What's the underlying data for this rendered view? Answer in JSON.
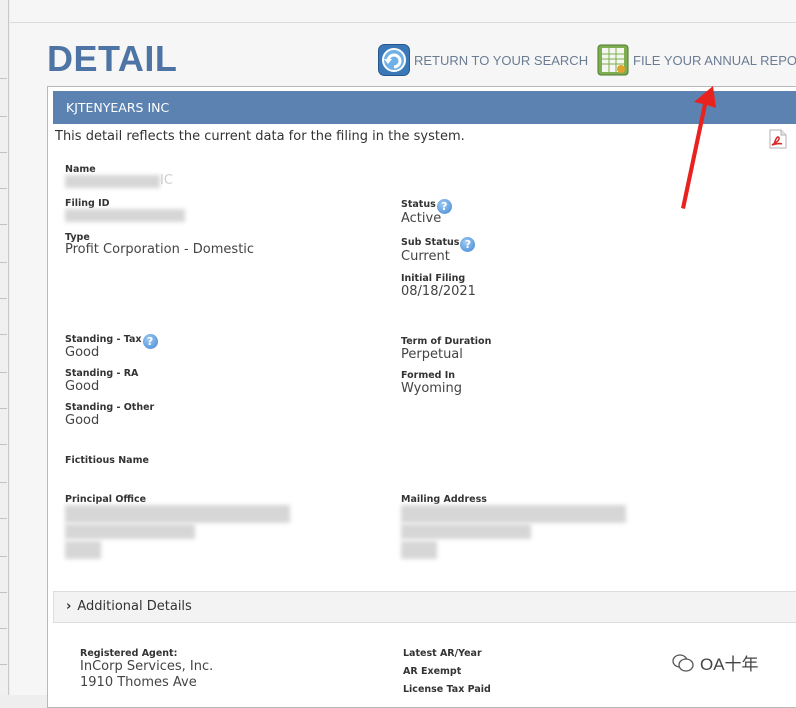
{
  "page": {
    "title": "DETAIL"
  },
  "nav": {
    "return_label": "RETURN TO YOUR SEARCH",
    "file_label": "FILE YOUR ANNUAL REPO"
  },
  "panel": {
    "company": "KJTENYEARS INC",
    "intro": "This detail reflects the current data for the filing in the system."
  },
  "fields": {
    "name_label": "Name",
    "name_value_suffix": "IC",
    "filing_id_label": "Filing ID",
    "type_label": "Type",
    "type_value": "Profit Corporation - Domestic",
    "status_label": "Status",
    "status_value": "Active",
    "sub_status_label": "Sub Status",
    "sub_status_value": "Current",
    "initial_filing_label": "Initial Filing",
    "initial_filing_value": "08/18/2021",
    "standing_tax_label": "Standing - Tax",
    "standing_tax_value": "Good",
    "standing_ra_label": "Standing - RA",
    "standing_ra_value": "Good",
    "standing_other_label": "Standing - Other",
    "standing_other_value": "Good",
    "term_label": "Term of Duration",
    "term_value": "Perpetual",
    "formed_in_label": "Formed In",
    "formed_in_value": "Wyoming",
    "fictitious_label": "Fictitious Name",
    "principal_label": "Principal Office",
    "mailing_label": "Mailing Address"
  },
  "additional": {
    "title": "Additional Details",
    "registered_agent_label": "Registered Agent:",
    "registered_agent_name": "InCorp Services, Inc.",
    "registered_agent_address": "1910 Thomes Ave",
    "latest_ar_label": "Latest AR/Year",
    "ar_exempt_label": "AR Exempt",
    "license_tax_label": "License Tax Paid"
  },
  "help_glyph": "?",
  "chevron_glyph": "›",
  "watermark": {
    "text": "OA十年"
  },
  "colors": {
    "header_bg": "#5b82b0",
    "title": "#4d74a4",
    "arrow": "#e8221f",
    "help": "#3f86d2"
  }
}
